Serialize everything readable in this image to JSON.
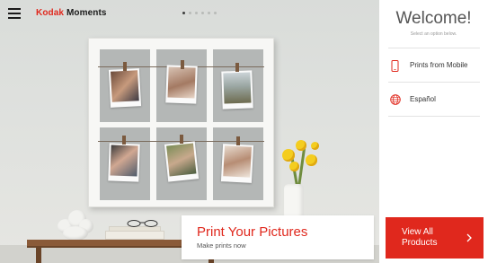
{
  "header": {
    "logo_brand": "Kodak",
    "logo_product": "Moments",
    "menu_icon": "hamburger-menu-icon",
    "carousel_dots_count": 6,
    "carousel_active_index": 0
  },
  "hero": {
    "card_title": "Print Your Pictures",
    "card_subtitle": "Make prints now"
  },
  "sidebar": {
    "title": "Welcome!",
    "subtitle": "Select an option below.",
    "items": [
      {
        "label": "Prints from Mobile",
        "icon": "mobile-phone-icon"
      },
      {
        "label": "Español",
        "icon": "globe-icon"
      }
    ],
    "cta_label": "View All Products",
    "cta_icon": "chevron-right-icon"
  },
  "colors": {
    "accent": "#e0281d",
    "text_dark": "#333333",
    "text_muted": "#999999"
  }
}
